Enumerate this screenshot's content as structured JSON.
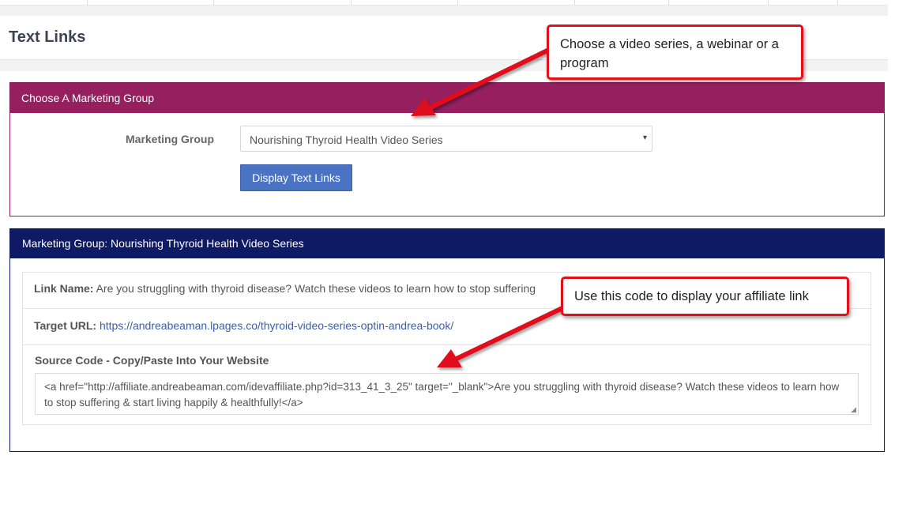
{
  "page": {
    "title": "Text Links"
  },
  "choose_panel": {
    "header": "Choose A Marketing Group",
    "field_label": "Marketing Group",
    "selected_value": "Nourishing Thyroid Health Video Series",
    "button_label": "Display Text Links"
  },
  "links_panel": {
    "header": "Marketing Group: Nourishing Thyroid Health Video Series",
    "link_name_label": "Link Name:",
    "link_name_value": "Are you struggling with thyroid disease? Watch these videos to learn how to stop suffering",
    "target_url_label": "Target URL:",
    "target_url_value": "https://andreabeaman.lpages.co/thyroid-video-series-optin-andrea-book/",
    "source_code_label": "Source Code - Copy/Paste Into Your Website",
    "source_code_value": "<a href=\"http://affiliate.andreabeaman.com/idevaffiliate.php?id=313_41_3_25\" target=\"_blank\">Are you struggling with thyroid disease? Watch these videos to learn how to stop suffering & start living happily & healthfully!</a>"
  },
  "callouts": {
    "choose": "Choose a video series, a webinar or a program",
    "code": "Use this code to display your affiliate link"
  },
  "icons": {
    "select_caret": "▾",
    "resize_handle": "◢"
  },
  "colors": {
    "choose_header": "#951f5f",
    "links_header": "#0e1a63",
    "button": "#4a73c4",
    "callout_border": "#e0111b",
    "link": "#3a5ea8"
  }
}
